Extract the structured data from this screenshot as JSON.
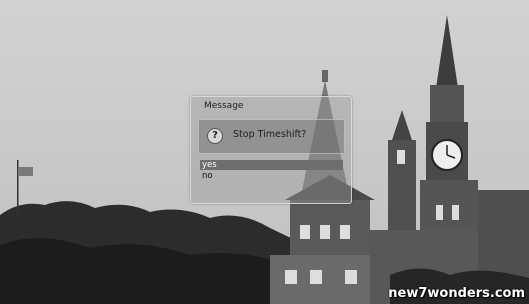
{
  "dialog": {
    "title": "Message",
    "message": "Stop Timeshift?",
    "options": [
      "yes",
      "no"
    ],
    "selected": "yes"
  },
  "watermark": "new7wonders.com",
  "icons": {
    "question": "question-icon"
  }
}
